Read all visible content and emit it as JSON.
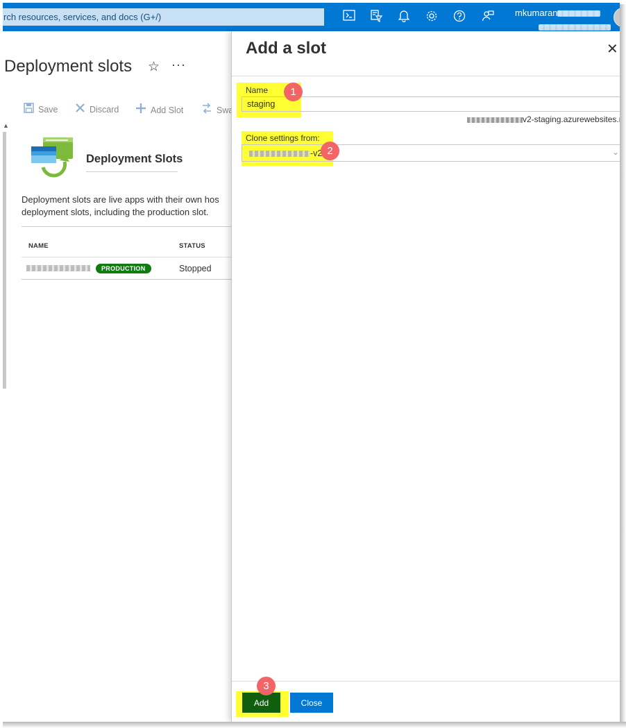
{
  "topbar": {
    "search_placeholder": "rch resources, services, and docs (G+/)",
    "icons": [
      "cloud-shell-icon",
      "directory-filter-icon",
      "notifications-icon",
      "settings-icon",
      "help-icon",
      "feedback-icon"
    ],
    "user_name": "mkumaran",
    "accent": "#0078d4"
  },
  "page": {
    "title": "Deployment slots",
    "toolbar": {
      "save": "Save",
      "discard": "Discard",
      "add_slot": "Add Slot",
      "swap": "Swa"
    },
    "section": {
      "heading": "Deployment Slots",
      "description_line1": "Deployment slots are live apps with their own hos",
      "description_line2": "deployment slots, including the production slot."
    },
    "table": {
      "columns": [
        "NAME",
        "STATUS"
      ],
      "rows": [
        {
          "badge": "PRODUCTION",
          "status": "Stopped"
        }
      ]
    }
  },
  "blade": {
    "title": "Add a slot",
    "name_label": "Name",
    "name_value": "staging",
    "hostname_suffix": "v2-staging.azurewebsites.n",
    "clone_label": "Clone settings from:",
    "clone_value_suffix": "-v2",
    "add_label": "Add",
    "close_label": "Close",
    "steps": [
      "1",
      "2",
      "3"
    ],
    "highlight_color": "#ffff33",
    "step_color": "#f26465"
  }
}
